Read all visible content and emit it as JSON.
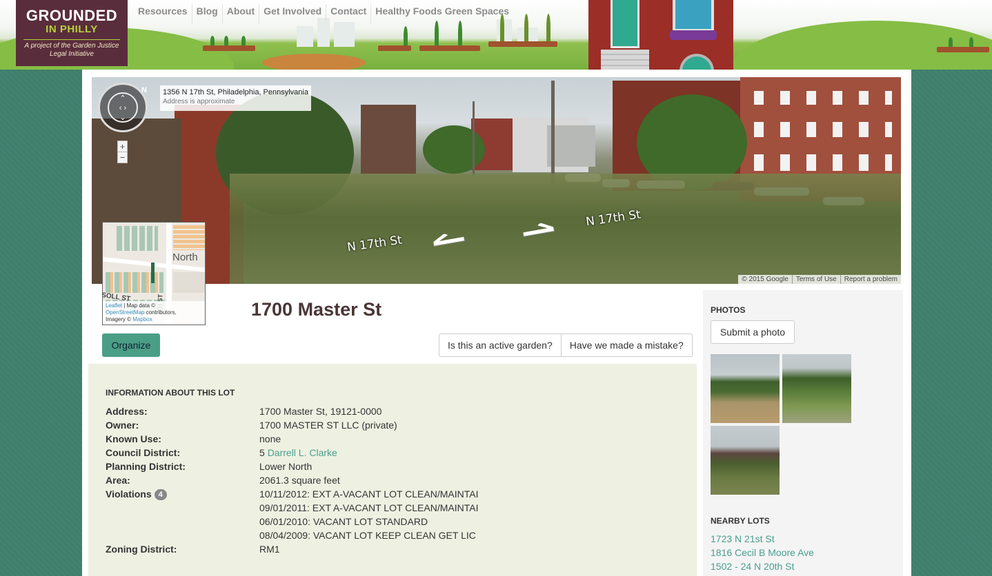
{
  "logo": {
    "line1": "GROUNDED",
    "line2": "IN PHILLY",
    "tagline": "A project of the Garden Justice Legal Initiative"
  },
  "nav": [
    "Resources",
    "Blog",
    "About",
    "Get Involved",
    "Contact",
    "Healthy Foods Green Spaces"
  ],
  "streetview": {
    "address": "1356 N 17th St, Philadelphia, Pennsylvania",
    "approx": "Address is approximate",
    "compass_n": "N",
    "zoom_in": "+",
    "zoom_out": "−",
    "street_left": "N 17th St",
    "street_right": "N 17th St",
    "footer": [
      "© 2015 Google",
      "Terms of Use",
      "Report a problem"
    ]
  },
  "minimap": {
    "north_label": "North",
    "soll_label": "SOLL ST",
    "street_label": "TH ST",
    "attribution_leaflet": "Leaflet",
    "attribution_mapdata": " | Map data ©",
    "attribution_osm": "OpenStreetMap",
    "attribution_contrib": " contributors,",
    "attribution_imagery": "Imagery ©",
    "attribution_mapbox": "Mapbox"
  },
  "lot": {
    "title": "1700 Master St",
    "organize_label": "Organize",
    "active_garden_label": "Is this an active garden?",
    "mistake_label": "Have we made a mistake?"
  },
  "info": {
    "heading": "INFORMATION ABOUT THIS LOT",
    "address_key": "Address:",
    "address_val": "1700 Master St, 19121-0000",
    "owner_key": "Owner:",
    "owner_val": "1700 MASTER ST LLC (private)",
    "use_key": "Known Use:",
    "use_val": "none",
    "council_key": "Council District:",
    "council_num": "5",
    "council_name": "Darrell L. Clarke",
    "planning_key": "Planning District:",
    "planning_val": "Lower North",
    "area_key": "Area:",
    "area_val": "2061.3 square feet",
    "violations_key": "Violations",
    "violations_count": "4",
    "violations": [
      "10/11/2012: EXT A-VACANT LOT CLEAN/MAINTAI",
      "09/01/2011: EXT A-VACANT LOT CLEAN/MAINTAI",
      "06/01/2010: VACANT LOT STANDARD",
      "08/04/2009: VACANT LOT KEEP CLEAN GET LIC"
    ],
    "zoning_key": "Zoning District:",
    "zoning_val": "RM1"
  },
  "sidebar": {
    "photos_heading": "PHOTOS",
    "submit_label": "Submit a photo",
    "nearby_heading": "NEARBY LOTS",
    "nearby": [
      "1723 N 21st St",
      "1816 Cecil B Moore Ave",
      "1502 - 24 N 20th St"
    ]
  },
  "colors": {
    "background": "#3f7f6c",
    "logo_bg": "#5a2d3c",
    "logo_accent": "#b6d03c",
    "primary_button": "#4b9e86",
    "link": "#4a9e8f",
    "info_panel": "#eef1e2"
  }
}
